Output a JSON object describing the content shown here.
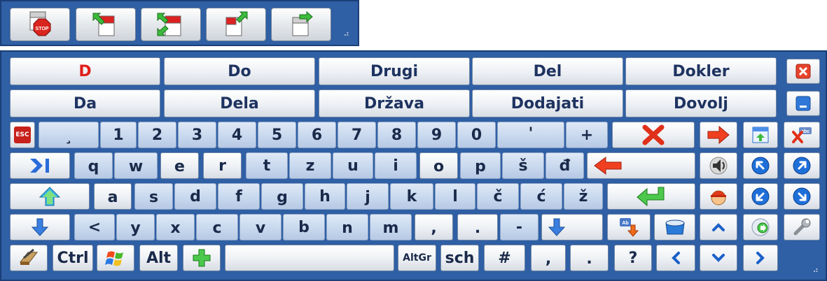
{
  "toolbar": {
    "buttons": [
      {
        "name": "stop-window-button",
        "icon": "stop-sign-window-icon",
        "label": "STOP"
      },
      {
        "name": "dock-top-button",
        "icon": "window-arrow-in-icon"
      },
      {
        "name": "dock-both-button",
        "icon": "window-double-arrow-icon"
      },
      {
        "name": "dock-out-button",
        "icon": "window-arrow-out-icon"
      },
      {
        "name": "float-right-button",
        "icon": "window-arrow-right-icon"
      }
    ]
  },
  "predictions": {
    "row1": [
      "D",
      "Do",
      "Drugi",
      "Del",
      "Dokler"
    ],
    "row2": [
      "Da",
      "Dela",
      "Država",
      "Dodajati",
      "Dovolj"
    ]
  },
  "keys": {
    "esc": "ESC",
    "row_numbers": [
      "¸",
      "1",
      "2",
      "3",
      "4",
      "5",
      "6",
      "7",
      "8",
      "9",
      "0",
      "'",
      "+"
    ],
    "row_q": [
      "q",
      "w",
      "e",
      "r",
      "t",
      "z",
      "u",
      "i",
      "o",
      "p",
      "š",
      "đ"
    ],
    "row_a": [
      "a",
      "s",
      "d",
      "f",
      "g",
      "h",
      "j",
      "k",
      "l",
      "č",
      "ć",
      "ž"
    ],
    "row_z": [
      "<",
      "y",
      "x",
      "c",
      "v",
      "b",
      "n",
      "m",
      ",",
      ".",
      "-"
    ],
    "bottom": {
      "ctrl": "Ctrl",
      "alt": "Alt",
      "altgr": "AltGr",
      "sch": "sch",
      "hash": "#",
      "comma": ",",
      "period": ".",
      "question": "?"
    }
  },
  "colors": {
    "frame": "#2f5fa4",
    "accent_red": "#e0201b"
  }
}
